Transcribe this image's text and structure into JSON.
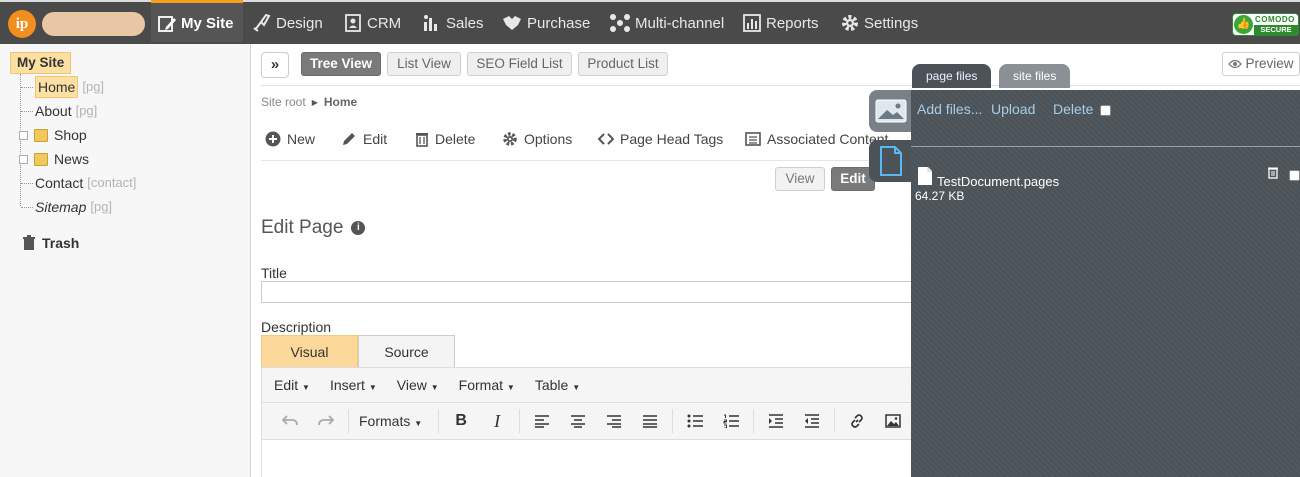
{
  "nav": {
    "items": [
      {
        "label": "My Site",
        "icon": "edit-page-icon",
        "active": true
      },
      {
        "label": "Design",
        "icon": "brush-icon"
      },
      {
        "label": "CRM",
        "icon": "contacts-icon"
      },
      {
        "label": "Sales",
        "icon": "sales-chart-icon"
      },
      {
        "label": "Purchase",
        "icon": "handshake-icon"
      },
      {
        "label": "Multi-channel",
        "icon": "network-icon"
      },
      {
        "label": "Reports",
        "icon": "bar-report-icon"
      },
      {
        "label": "Settings",
        "icon": "gear-icon"
      }
    ],
    "badge": {
      "line1": "COMODO",
      "line2": "SECURE"
    },
    "logo_text": "ip"
  },
  "tree": {
    "root": "My Site",
    "items": [
      {
        "label": "Home",
        "tag": "[pg]"
      },
      {
        "label": "About",
        "tag": "[pg]"
      },
      {
        "label": "Shop",
        "tag": ""
      },
      {
        "label": "News",
        "tag": ""
      },
      {
        "label": "Contact",
        "tag": "[contact]"
      },
      {
        "label": "Sitemap",
        "tag": "[pg]"
      }
    ],
    "trash": "Trash"
  },
  "views": {
    "expand": "»",
    "tabs": [
      "Tree View",
      "List View",
      "SEO Field List",
      "Product List"
    ],
    "preview": "Preview"
  },
  "breadcrumb": {
    "root": "Site root",
    "current": "Home"
  },
  "actions": [
    "New",
    "Edit",
    "Delete",
    "Options",
    "Page Head Tags",
    "Associated Content"
  ],
  "mode": {
    "view": "View",
    "edit": "Edit"
  },
  "form": {
    "heading": "Edit Page",
    "info": "i",
    "title_label": "Title",
    "title_value": "",
    "description_label": "Description",
    "editor_tabs": [
      "Visual",
      "Source"
    ],
    "menus": [
      "Edit",
      "Insert",
      "View",
      "Format",
      "Table"
    ],
    "formats": "Formats"
  },
  "files": {
    "tabs": [
      "page files",
      "site files"
    ],
    "add": "Add files...",
    "upload": "Upload",
    "delete": "Delete",
    "file_name": "TestDocument.pages",
    "file_size": "64.27 KB"
  },
  "colors": {
    "accent": "#f6a019",
    "nav_bg": "#4a4a4a",
    "panel_bg": "#4b5359",
    "highlight": "#fce0a3"
  }
}
